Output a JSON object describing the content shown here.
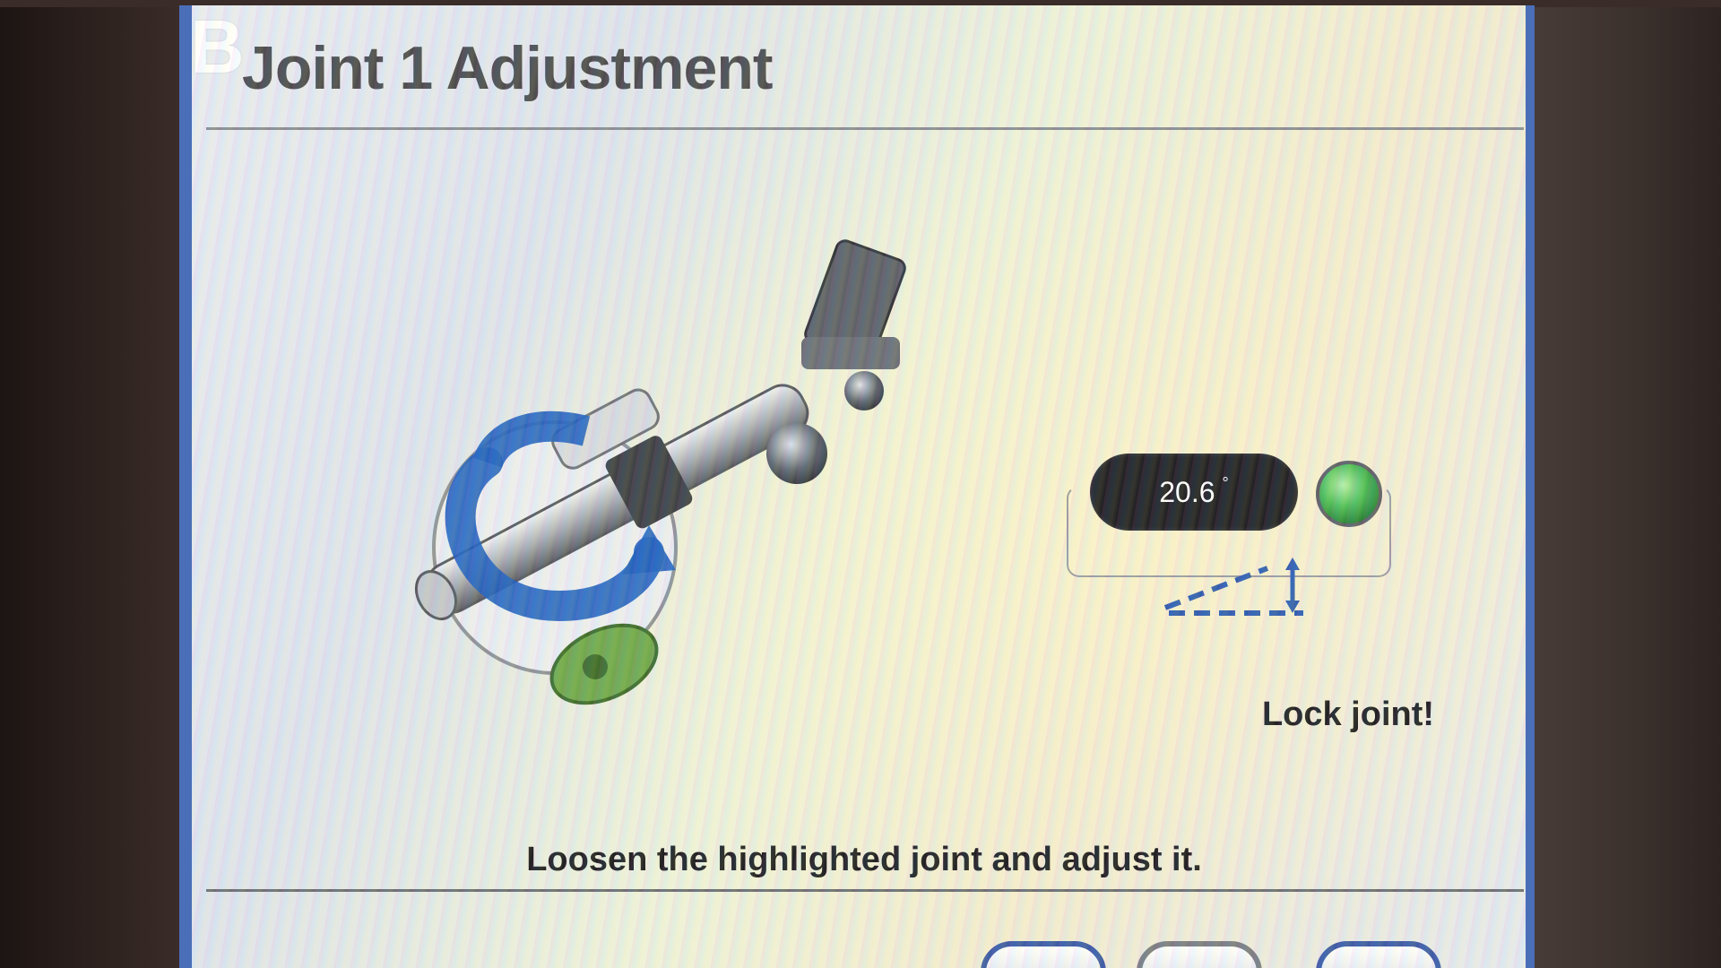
{
  "step_letter": "B",
  "header": {
    "title": "Joint 1 Adjustment"
  },
  "readout": {
    "value": "20.6",
    "unit": "°",
    "status_color": "#3fae4c"
  },
  "status": {
    "message": "Lock joint!"
  },
  "instruction": "Loosen the highlighted joint and adjust it.",
  "buttons": {
    "back_label": "",
    "proceed_label": "",
    "cancel_label": ""
  },
  "colors": {
    "accent": "#4a6fb8",
    "rotation_arrow": "#1f5fbf",
    "joint_highlight": "#4caf50"
  }
}
